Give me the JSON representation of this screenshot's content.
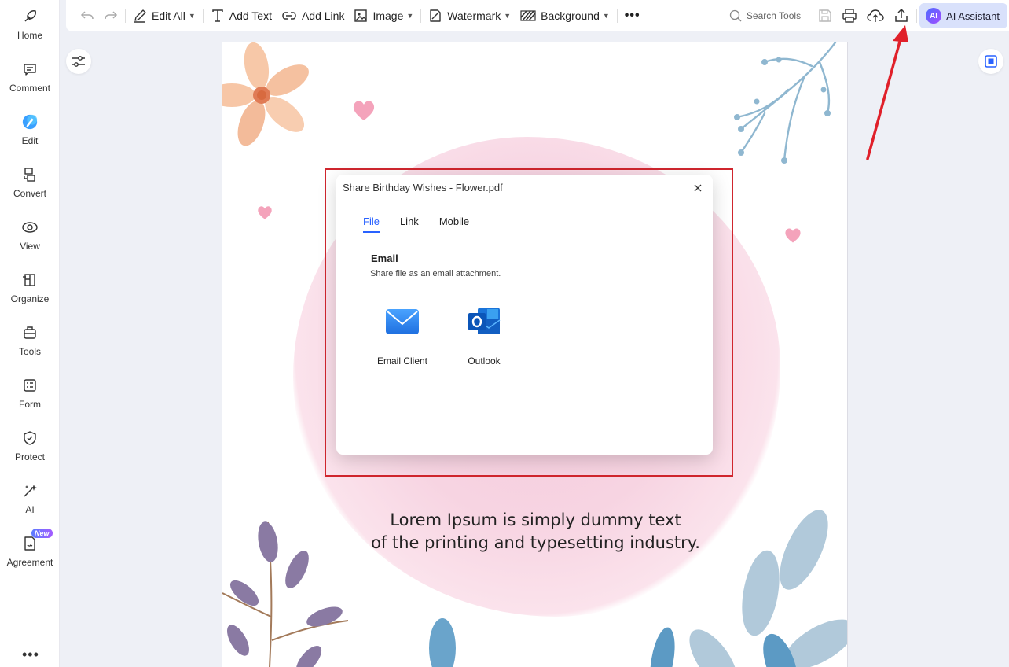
{
  "sidebar": {
    "items": [
      {
        "label": "Home",
        "icon": "home-icon"
      },
      {
        "label": "Comment",
        "icon": "comment-icon"
      },
      {
        "label": "Edit",
        "icon": "edit-icon"
      },
      {
        "label": "Convert",
        "icon": "convert-icon"
      },
      {
        "label": "View",
        "icon": "view-icon"
      },
      {
        "label": "Organize",
        "icon": "organize-icon"
      },
      {
        "label": "Tools",
        "icon": "tools-icon"
      },
      {
        "label": "Form",
        "icon": "form-icon"
      },
      {
        "label": "Protect",
        "icon": "protect-icon"
      },
      {
        "label": "AI",
        "icon": "ai-sparkle-icon"
      },
      {
        "label": "Agreement",
        "icon": "agreement-icon",
        "badge": "New"
      }
    ],
    "more_label": "•••"
  },
  "toolbar": {
    "edit_all": "Edit All",
    "add_text": "Add Text",
    "add_link": "Add Link",
    "image": "Image",
    "watermark": "Watermark",
    "background": "Background",
    "more": "•••",
    "search_placeholder": "Search Tools",
    "ai_assistant": "AI Assistant",
    "ai_logo_text": "AI"
  },
  "document": {
    "line1": "Lorem Ipsum is simply dummy text",
    "line2": "of the printing and typesetting industry."
  },
  "dialog": {
    "title": "Share Birthday Wishes - Flower.pdf",
    "tabs": [
      "File",
      "Link",
      "Mobile"
    ],
    "active_tab": "File",
    "section_title": "Email",
    "section_subtitle": "Share file as an email attachment.",
    "options": [
      {
        "label": "Email Client",
        "icon": "envelope-icon"
      },
      {
        "label": "Outlook",
        "icon": "outlook-icon"
      }
    ]
  },
  "colors": {
    "accent": "#2962ff",
    "highlight": "#d0262e",
    "arrow": "#e0202a",
    "ai_button_bg": "#d9e1fb"
  }
}
